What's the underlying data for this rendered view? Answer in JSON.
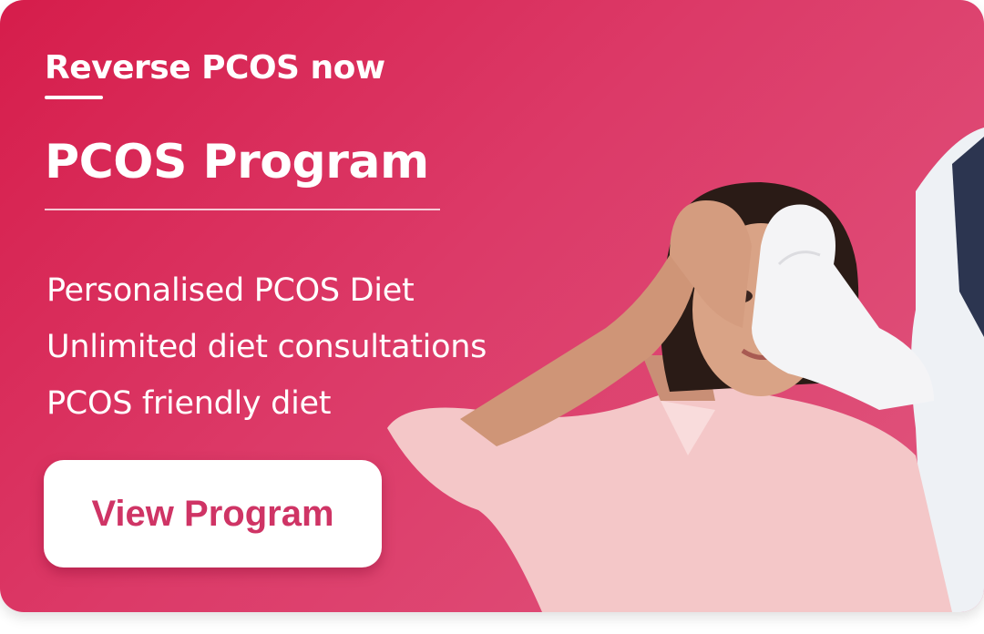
{
  "banner": {
    "eyebrow": "Reverse PCOS now",
    "title": "PCOS Program",
    "features": [
      "Personalised PCOS Diet",
      "Unlimited diet consultations",
      "PCOS friendly diet"
    ],
    "cta_label": "View Program"
  },
  "colors": {
    "gradient_start": "#d61d4b",
    "gradient_end": "#e0577f",
    "cta_text": "#cf3465",
    "text": "#ffffff"
  }
}
